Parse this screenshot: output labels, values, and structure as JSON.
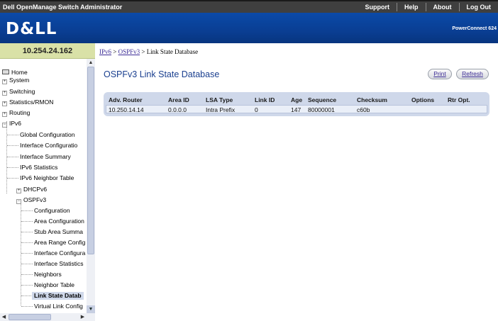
{
  "app": {
    "title": "Dell OpenManage Switch Administrator",
    "logo_text": "D&LL",
    "product": "PowerConnect 624"
  },
  "topnav": [
    {
      "label": "Support"
    },
    {
      "label": "Help"
    },
    {
      "label": "About"
    },
    {
      "label": "Log Out"
    }
  ],
  "device": {
    "ip": "10.254.24.162"
  },
  "sidebar": {
    "items": {
      "home": "Home",
      "system": "System",
      "switching": "Switching",
      "statistics": "Statistics/RMON",
      "routing": "Routing",
      "ipv6": "IPv6",
      "global_config": "Global Configuration",
      "interface_config": "Interface Configuratio",
      "interface_summary": "Interface Summary",
      "ipv6_stats": "IPv6 Statistics",
      "ipv6_neighbor_table": "IPv6 Neighbor Table",
      "dhcpv6": "DHCPv6",
      "ospfv3": "OSPFv3",
      "ospf_configuration": "Configuration",
      "area_configuration": "Area Configuration",
      "stub_area_summary": "Stub Area Summa",
      "area_range_config": "Area Range Config",
      "ospf_interface_config": "Interface Configura",
      "ospf_interface_stats": "Interface Statistics",
      "neighbors": "Neighbors",
      "neighbor_table": "Neighbor Table",
      "link_state_db": "Link State Datab",
      "virtual_link_config": "Virtual Link Config"
    }
  },
  "breadcrumb": {
    "ipv6": "IPv6",
    "sep1": " > ",
    "ospfv3": "OSPFv3",
    "sep2": " > ",
    "current": "Link State Database"
  },
  "page": {
    "title": "OSPFv3 Link State Database",
    "print_label": "Print",
    "refresh_label": "Refresh"
  },
  "table": {
    "headers": {
      "adv_router": "Adv. Router",
      "area_id": "Area ID",
      "lsa_type": "LSA Type",
      "link_id": "Link ID",
      "age": "Age",
      "sequence": "Sequence",
      "checksum": "Checksum",
      "options": "Options",
      "rtr_opt": "Rtr Opt."
    },
    "rows": [
      {
        "adv_router": "10.250.14.14",
        "area_id": "0.0.0.0",
        "lsa_type": "Intra Prefix",
        "link_id": "0",
        "age": "147",
        "sequence": "80000001",
        "checksum": "c60b",
        "options": "",
        "rtr_opt": ""
      }
    ]
  }
}
